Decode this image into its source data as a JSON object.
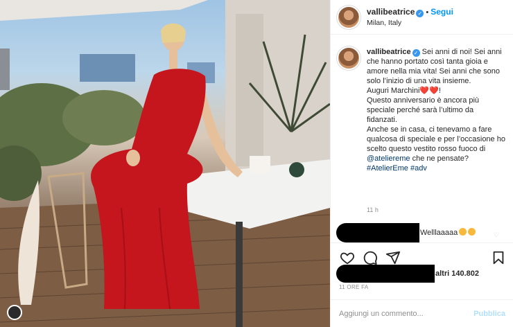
{
  "header": {
    "username": "vallibeatrice",
    "follow_label": "Segui",
    "location": "Milan, Italy",
    "separator": "•"
  },
  "caption": {
    "username": "vallibeatrice",
    "p1": "Sei anni di noi! Sei anni che hanno portato così tanta gioia e amore nella mia vita! Sei anni che sono solo l’inizio di una vita insieme.",
    "p2": "Auguri Marchini",
    "p3": "Questo anniversario è ancora più speciale perché sarà l’ultimo da fidanzati.",
    "p4a": "Anche se in casa, ci tenevamo a fare qualcosa di speciale e per l’occasione ho scelto questo vestito rosso fuoco di ",
    "mention": "@ateliereme",
    "p4b": " che ne pensate?",
    "hashtag1": "#AtelierEme",
    "hashtag2": "#adv",
    "time": "11 h"
  },
  "comment": {
    "text": "Welllaaaaa"
  },
  "likes": {
    "text": "altri 140.802"
  },
  "date": "11 ORE FA",
  "add_comment": {
    "placeholder": "Aggiungi un commento...",
    "publish_label": "Pubblica"
  },
  "icons": {
    "verified": "verified-badge-icon",
    "like": "heart-icon",
    "comment": "comment-bubble-icon",
    "share": "paper-plane-icon",
    "save": "bookmark-icon"
  },
  "colors": {
    "accent": "#0095f6",
    "verified": "#3897f0",
    "dress": "#c4161c",
    "publish_disabled": "#b2dffc"
  }
}
